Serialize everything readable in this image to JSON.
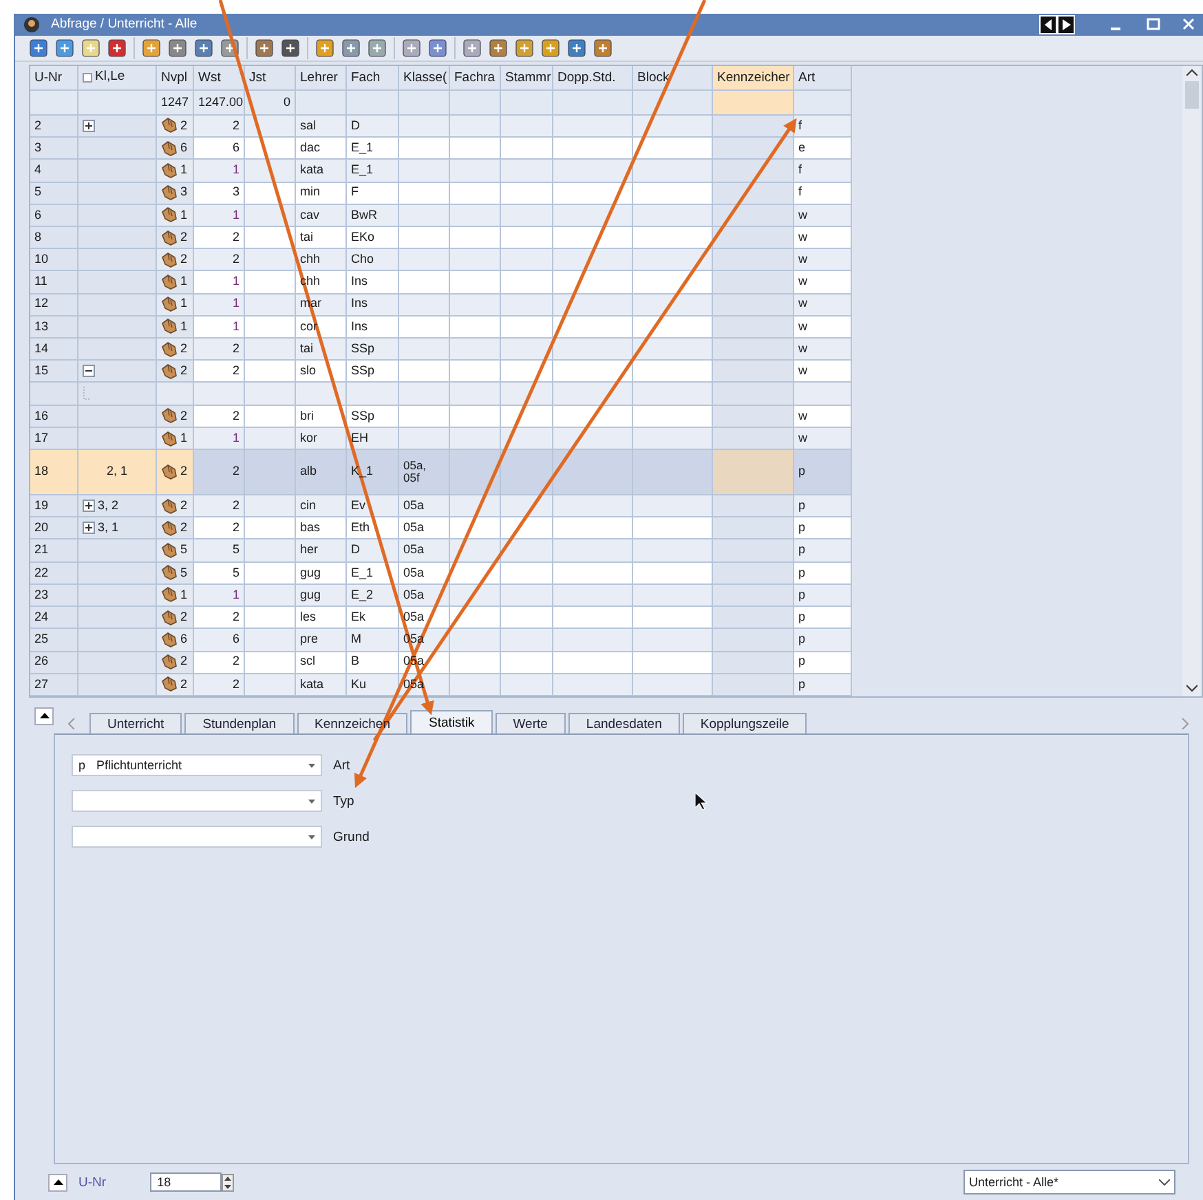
{
  "window": {
    "title": "Abfrage / Unterricht - Alle"
  },
  "table": {
    "columns": [
      "U-Nr",
      "Kl,Le",
      "Nvpl",
      "Wst",
      "Jst",
      "Lehrer",
      "Fach",
      "Klasse(",
      "Fachra",
      "Stammr",
      "Dopp.Std.",
      "Block",
      "Kennzeicher",
      "Art"
    ],
    "totals": {
      "nvpl": "1247",
      "wst": "1247.00",
      "jst": "0"
    },
    "rows": [
      {
        "kind": "group",
        "expanded": false,
        "selected": false,
        "unr": "2",
        "nvpl": "2",
        "wst": "2",
        "lehrer": "sal",
        "fach": "D",
        "art": "f"
      },
      {
        "kind": "row",
        "selected": false,
        "unr": "3",
        "nvpl": "6",
        "wst": "6",
        "lehrer": "dac",
        "fach": "E_1",
        "art": "e"
      },
      {
        "kind": "row",
        "selected": false,
        "unr": "4",
        "nvpl": "1",
        "wst": "1",
        "lehrer": "kata",
        "fach": "E_1",
        "art": "f"
      },
      {
        "kind": "row",
        "selected": false,
        "unr": "5",
        "nvpl": "3",
        "wst": "3",
        "lehrer": "min",
        "fach": "F",
        "art": "f"
      },
      {
        "kind": "row",
        "selected": false,
        "unr": "6",
        "nvpl": "1",
        "wst": "1",
        "lehrer": "cav",
        "fach": "BwR",
        "art": "w"
      },
      {
        "kind": "row",
        "selected": false,
        "unr": "8",
        "nvpl": "2",
        "wst": "2",
        "lehrer": "tai",
        "fach": "EKo",
        "art": "w"
      },
      {
        "kind": "row",
        "selected": false,
        "unr": "10",
        "nvpl": "2",
        "wst": "2",
        "lehrer": "chh",
        "fach": "Cho",
        "art": "w"
      },
      {
        "kind": "row",
        "selected": false,
        "unr": "11",
        "nvpl": "1",
        "wst": "1",
        "lehrer": "chh",
        "fach": "Ins",
        "art": "w"
      },
      {
        "kind": "row",
        "selected": false,
        "unr": "12",
        "nvpl": "1",
        "wst": "1",
        "lehrer": "mar",
        "fach": "Ins",
        "art": "w"
      },
      {
        "kind": "row",
        "selected": false,
        "unr": "13",
        "nvpl": "1",
        "wst": "1",
        "lehrer": "cor",
        "fach": "Ins",
        "art": "w"
      },
      {
        "kind": "row",
        "selected": false,
        "unr": "14",
        "nvpl": "2",
        "wst": "2",
        "lehrer": "tai",
        "fach": "SSp",
        "art": "w"
      },
      {
        "kind": "group",
        "expanded": true,
        "selected": false,
        "unr": "15",
        "nvpl": "2",
        "wst": "2",
        "lehrer": "slo",
        "fach": "SSp",
        "art": "w"
      },
      {
        "kind": "child",
        "selected": false
      },
      {
        "kind": "row",
        "selected": false,
        "unr": "16",
        "nvpl": "2",
        "wst": "2",
        "lehrer": "bri",
        "fach": "SSp",
        "art": "w"
      },
      {
        "kind": "row",
        "selected": false,
        "unr": "17",
        "nvpl": "1",
        "wst": "1",
        "lehrer": "kor",
        "fach": "EH",
        "art": "w"
      },
      {
        "kind": "row",
        "selected": true,
        "unr": "18",
        "klle": "2, 1",
        "nvpl": "2",
        "wst": "2",
        "lehrer": "alb",
        "fach": "K_1",
        "klasse": "05a, 05f",
        "art": "p"
      },
      {
        "kind": "group",
        "expanded": false,
        "selected": false,
        "unr": "19",
        "klle": "3, 2",
        "nvpl": "2",
        "wst": "2",
        "lehrer": "cin",
        "fach": "Ev",
        "klasse": "05a",
        "art": "p"
      },
      {
        "kind": "group",
        "expanded": false,
        "selected": false,
        "unr": "20",
        "klle": "3, 1",
        "nvpl": "2",
        "wst": "2",
        "lehrer": "bas",
        "fach": "Eth",
        "klasse": "05a",
        "art": "p"
      },
      {
        "kind": "row",
        "selected": false,
        "unr": "21",
        "nvpl": "5",
        "wst": "5",
        "lehrer": "her",
        "fach": "D",
        "klasse": "05a",
        "art": "p"
      },
      {
        "kind": "row",
        "selected": false,
        "unr": "22",
        "nvpl": "5",
        "wst": "5",
        "lehrer": "gug",
        "fach": "E_1",
        "klasse": "05a",
        "art": "p"
      },
      {
        "kind": "row",
        "selected": false,
        "unr": "23",
        "nvpl": "1",
        "wst": "1",
        "lehrer": "gug",
        "fach": "E_2",
        "klasse": "05a",
        "art": "p"
      },
      {
        "kind": "row",
        "selected": false,
        "unr": "24",
        "nvpl": "2",
        "wst": "2",
        "lehrer": "les",
        "fach": "Ek",
        "klasse": "05a",
        "art": "p"
      },
      {
        "kind": "row",
        "selected": false,
        "unr": "25",
        "nvpl": "6",
        "wst": "6",
        "lehrer": "pre",
        "fach": "M",
        "klasse": "05a",
        "art": "p"
      },
      {
        "kind": "row",
        "selected": false,
        "unr": "26",
        "nvpl": "2",
        "wst": "2",
        "lehrer": "scl",
        "fach": "B",
        "klasse": "05a",
        "art": "p"
      },
      {
        "kind": "row",
        "selected": false,
        "unr": "27",
        "nvpl": "2",
        "wst": "2",
        "lehrer": "kata",
        "fach": "Ku",
        "klasse": "05a",
        "art": "p"
      }
    ]
  },
  "tabs": [
    {
      "label": "Unterricht",
      "selected": false
    },
    {
      "label": "Stundenplan",
      "selected": false
    },
    {
      "label": "Kennzeichen",
      "selected": false
    },
    {
      "label": "Statistik",
      "selected": true
    },
    {
      "label": "Werte",
      "selected": false
    },
    {
      "label": "Landesdaten",
      "selected": false
    },
    {
      "label": "Kopplungszeile",
      "selected": false
    }
  ],
  "fields": [
    {
      "label": "Art",
      "code": "p",
      "value": "Pflichtunterricht"
    },
    {
      "label": "Typ"
    },
    {
      "label": "Grund"
    }
  ],
  "status_bar": {
    "label": "U-Nr",
    "value": "18",
    "view": "Unterricht - Alle*"
  }
}
